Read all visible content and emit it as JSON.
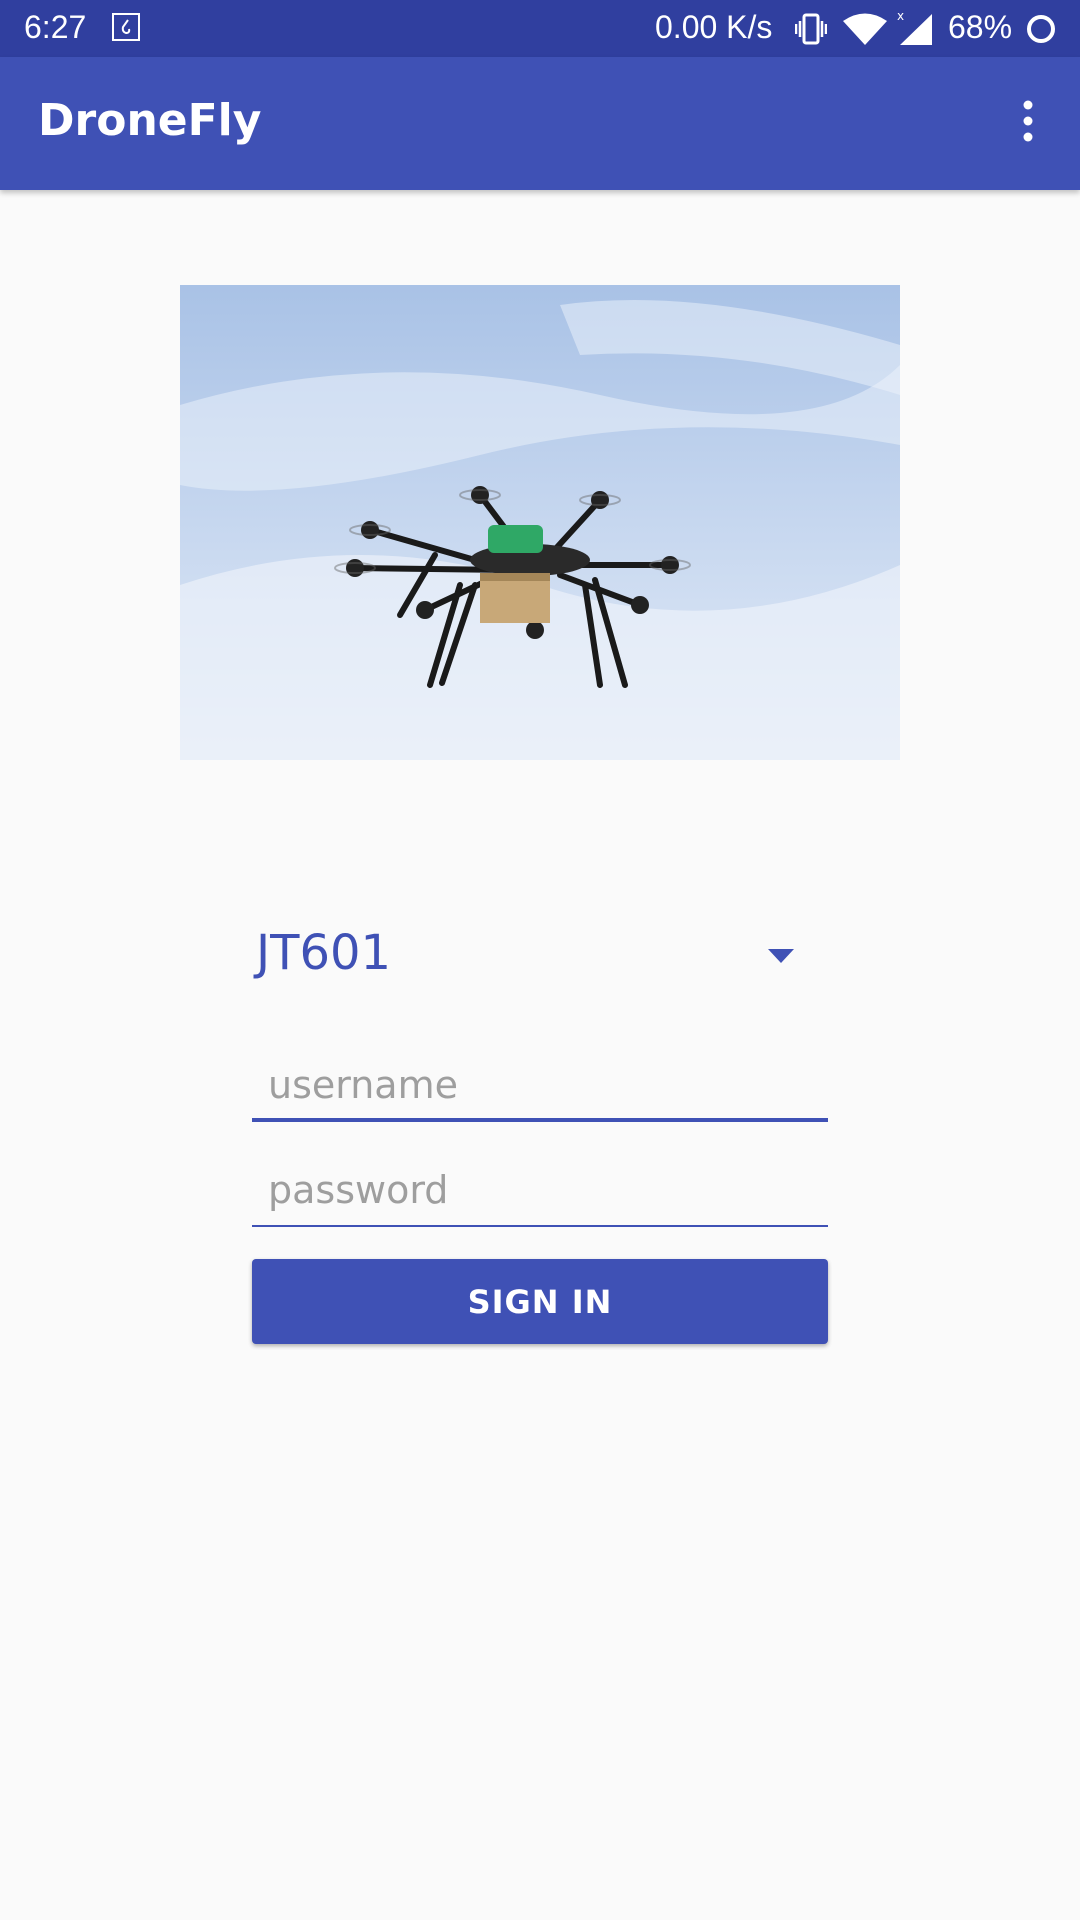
{
  "status_bar": {
    "time": "6:27",
    "net_speed": "0.00 K/s",
    "battery": "68%",
    "icons": [
      "notification-icon",
      "vibrate-icon",
      "wifi-icon",
      "signal-icon",
      "battery-icon"
    ]
  },
  "app_bar": {
    "title": "DroneFly",
    "menu_icon": "overflow-menu-icon"
  },
  "hero": {
    "icon": "drone-photo"
  },
  "form": {
    "flight_select": {
      "value": "JT601",
      "icon": "dropdown-arrow-icon"
    },
    "username": {
      "value": "",
      "placeholder": "username"
    },
    "password": {
      "value": "",
      "placeholder": "password"
    },
    "sign_in_label": "SIGN IN"
  },
  "colors": {
    "status_bar": "#303f9f",
    "primary": "#3f51b5",
    "background": "#fafafa",
    "placeholder": "#9e9e9e"
  }
}
